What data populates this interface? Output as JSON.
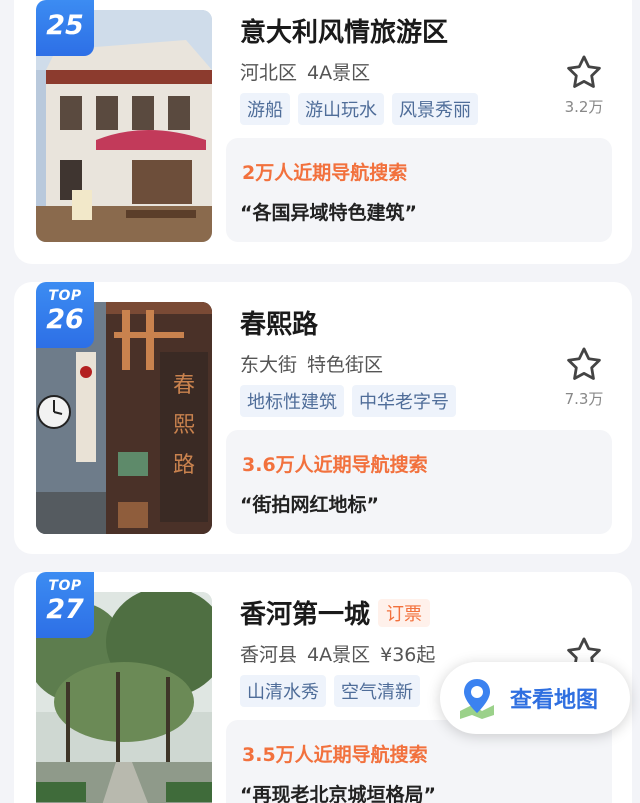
{
  "accent_color": "#2d6fe6",
  "highlight_color": "#f2713d",
  "tag_color": "#4f6d99",
  "items": [
    {
      "rank_prefix": "",
      "rank": "25",
      "name": "意大利风情旅游区",
      "ticket_label": "",
      "district": "河北区",
      "grade": "4A景区",
      "price": "",
      "tags": [
        "游船",
        "游山玩水",
        "风景秀丽"
      ],
      "favorites": "3.2万",
      "searches": "2万人近期导航搜索",
      "quote": "“各国异域特色建筑”",
      "star_icon": "star-outline-icon"
    },
    {
      "rank_prefix": "TOP",
      "rank": "26",
      "name": "春熙路",
      "ticket_label": "",
      "district": "东大街",
      "grade": "特色街区",
      "price": "",
      "tags": [
        "地标性建筑",
        "中华老字号"
      ],
      "favorites": "7.3万",
      "searches": "3.6万人近期导航搜索",
      "quote": "“街拍网红地标”",
      "star_icon": "star-outline-icon"
    },
    {
      "rank_prefix": "TOP",
      "rank": "27",
      "name": "香河第一城",
      "ticket_label": "订票",
      "district": "香河县",
      "grade": "4A景区",
      "price": "¥36起",
      "tags": [
        "山清水秀",
        "空气清新"
      ],
      "favorites": "",
      "searches": "3.5万人近期导航搜索",
      "quote": "“再现老北京城垣格局”",
      "star_icon": "star-outline-icon"
    }
  ],
  "map_button": {
    "label": "查看地图",
    "icon": "map-pin-icon"
  }
}
